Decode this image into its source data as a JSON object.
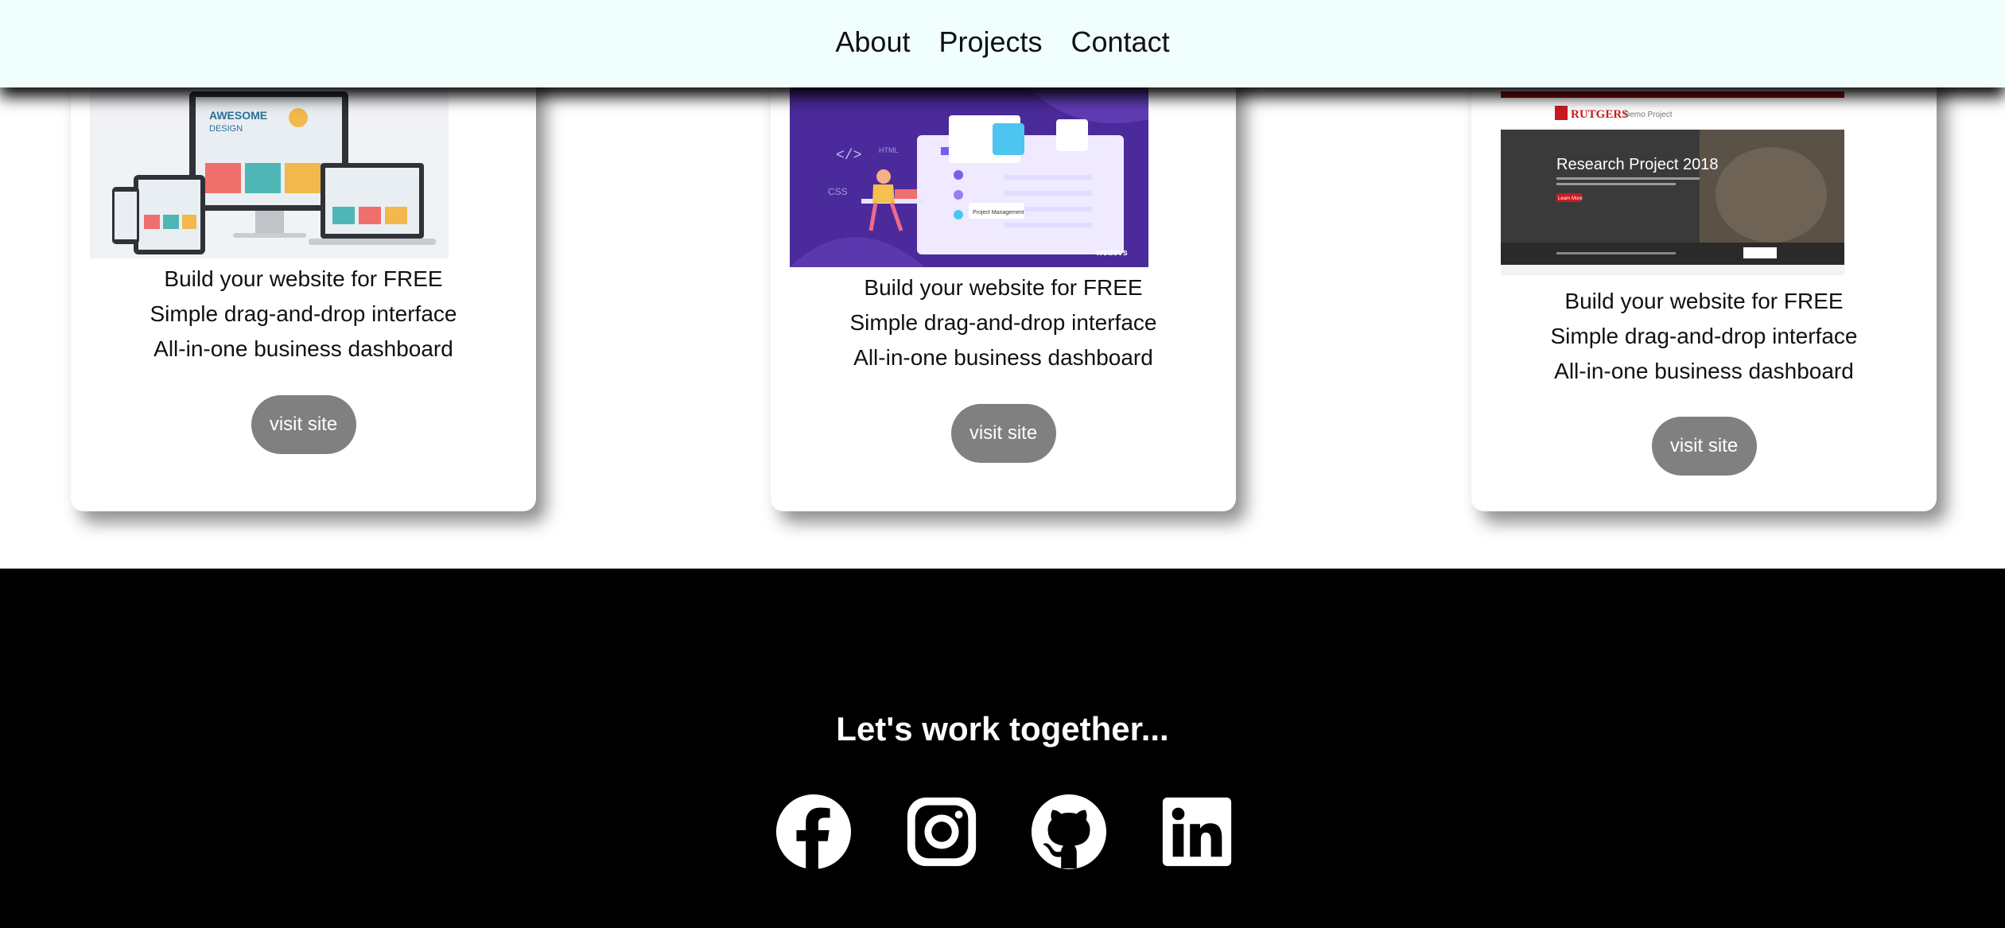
{
  "nav": {
    "items": [
      {
        "label": "About"
      },
      {
        "label": "Projects"
      },
      {
        "label": "Contact"
      }
    ]
  },
  "projects": [
    {
      "lines": [
        "Build your website for FREE",
        "Simple drag-and-drop interface",
        "All-in-one business dashboard"
      ],
      "button_label": "visit site",
      "thumbnail_text": [
        "AWESOME",
        "DESIGN"
      ]
    },
    {
      "lines": [
        "Build your website for FREE",
        "Simple drag-and-drop interface",
        "All-in-one business dashboard"
      ],
      "button_label": "visit site",
      "thumbnail_text": [
        "</>",
        "HTML",
        "CSS",
        "Project Management",
        "wedevs"
      ]
    },
    {
      "lines": [
        "Build your website for FREE",
        "Simple drag-and-drop interface",
        "All-in-one business dashboard"
      ],
      "button_label": "visit site",
      "thumbnail_text": [
        "RUTGERS",
        "Demo Project",
        "Research Project 2018",
        "Learn More"
      ]
    }
  ],
  "footer": {
    "title": "Let's work together...",
    "socials": [
      {
        "icon": "facebook-icon"
      },
      {
        "icon": "instagram-icon"
      },
      {
        "icon": "github-icon"
      },
      {
        "icon": "linkedin-icon"
      }
    ]
  },
  "colors": {
    "nav_background": "#f0fffe",
    "button_background": "#808080",
    "footer_background": "#000000",
    "footer_text": "#ffffff"
  }
}
